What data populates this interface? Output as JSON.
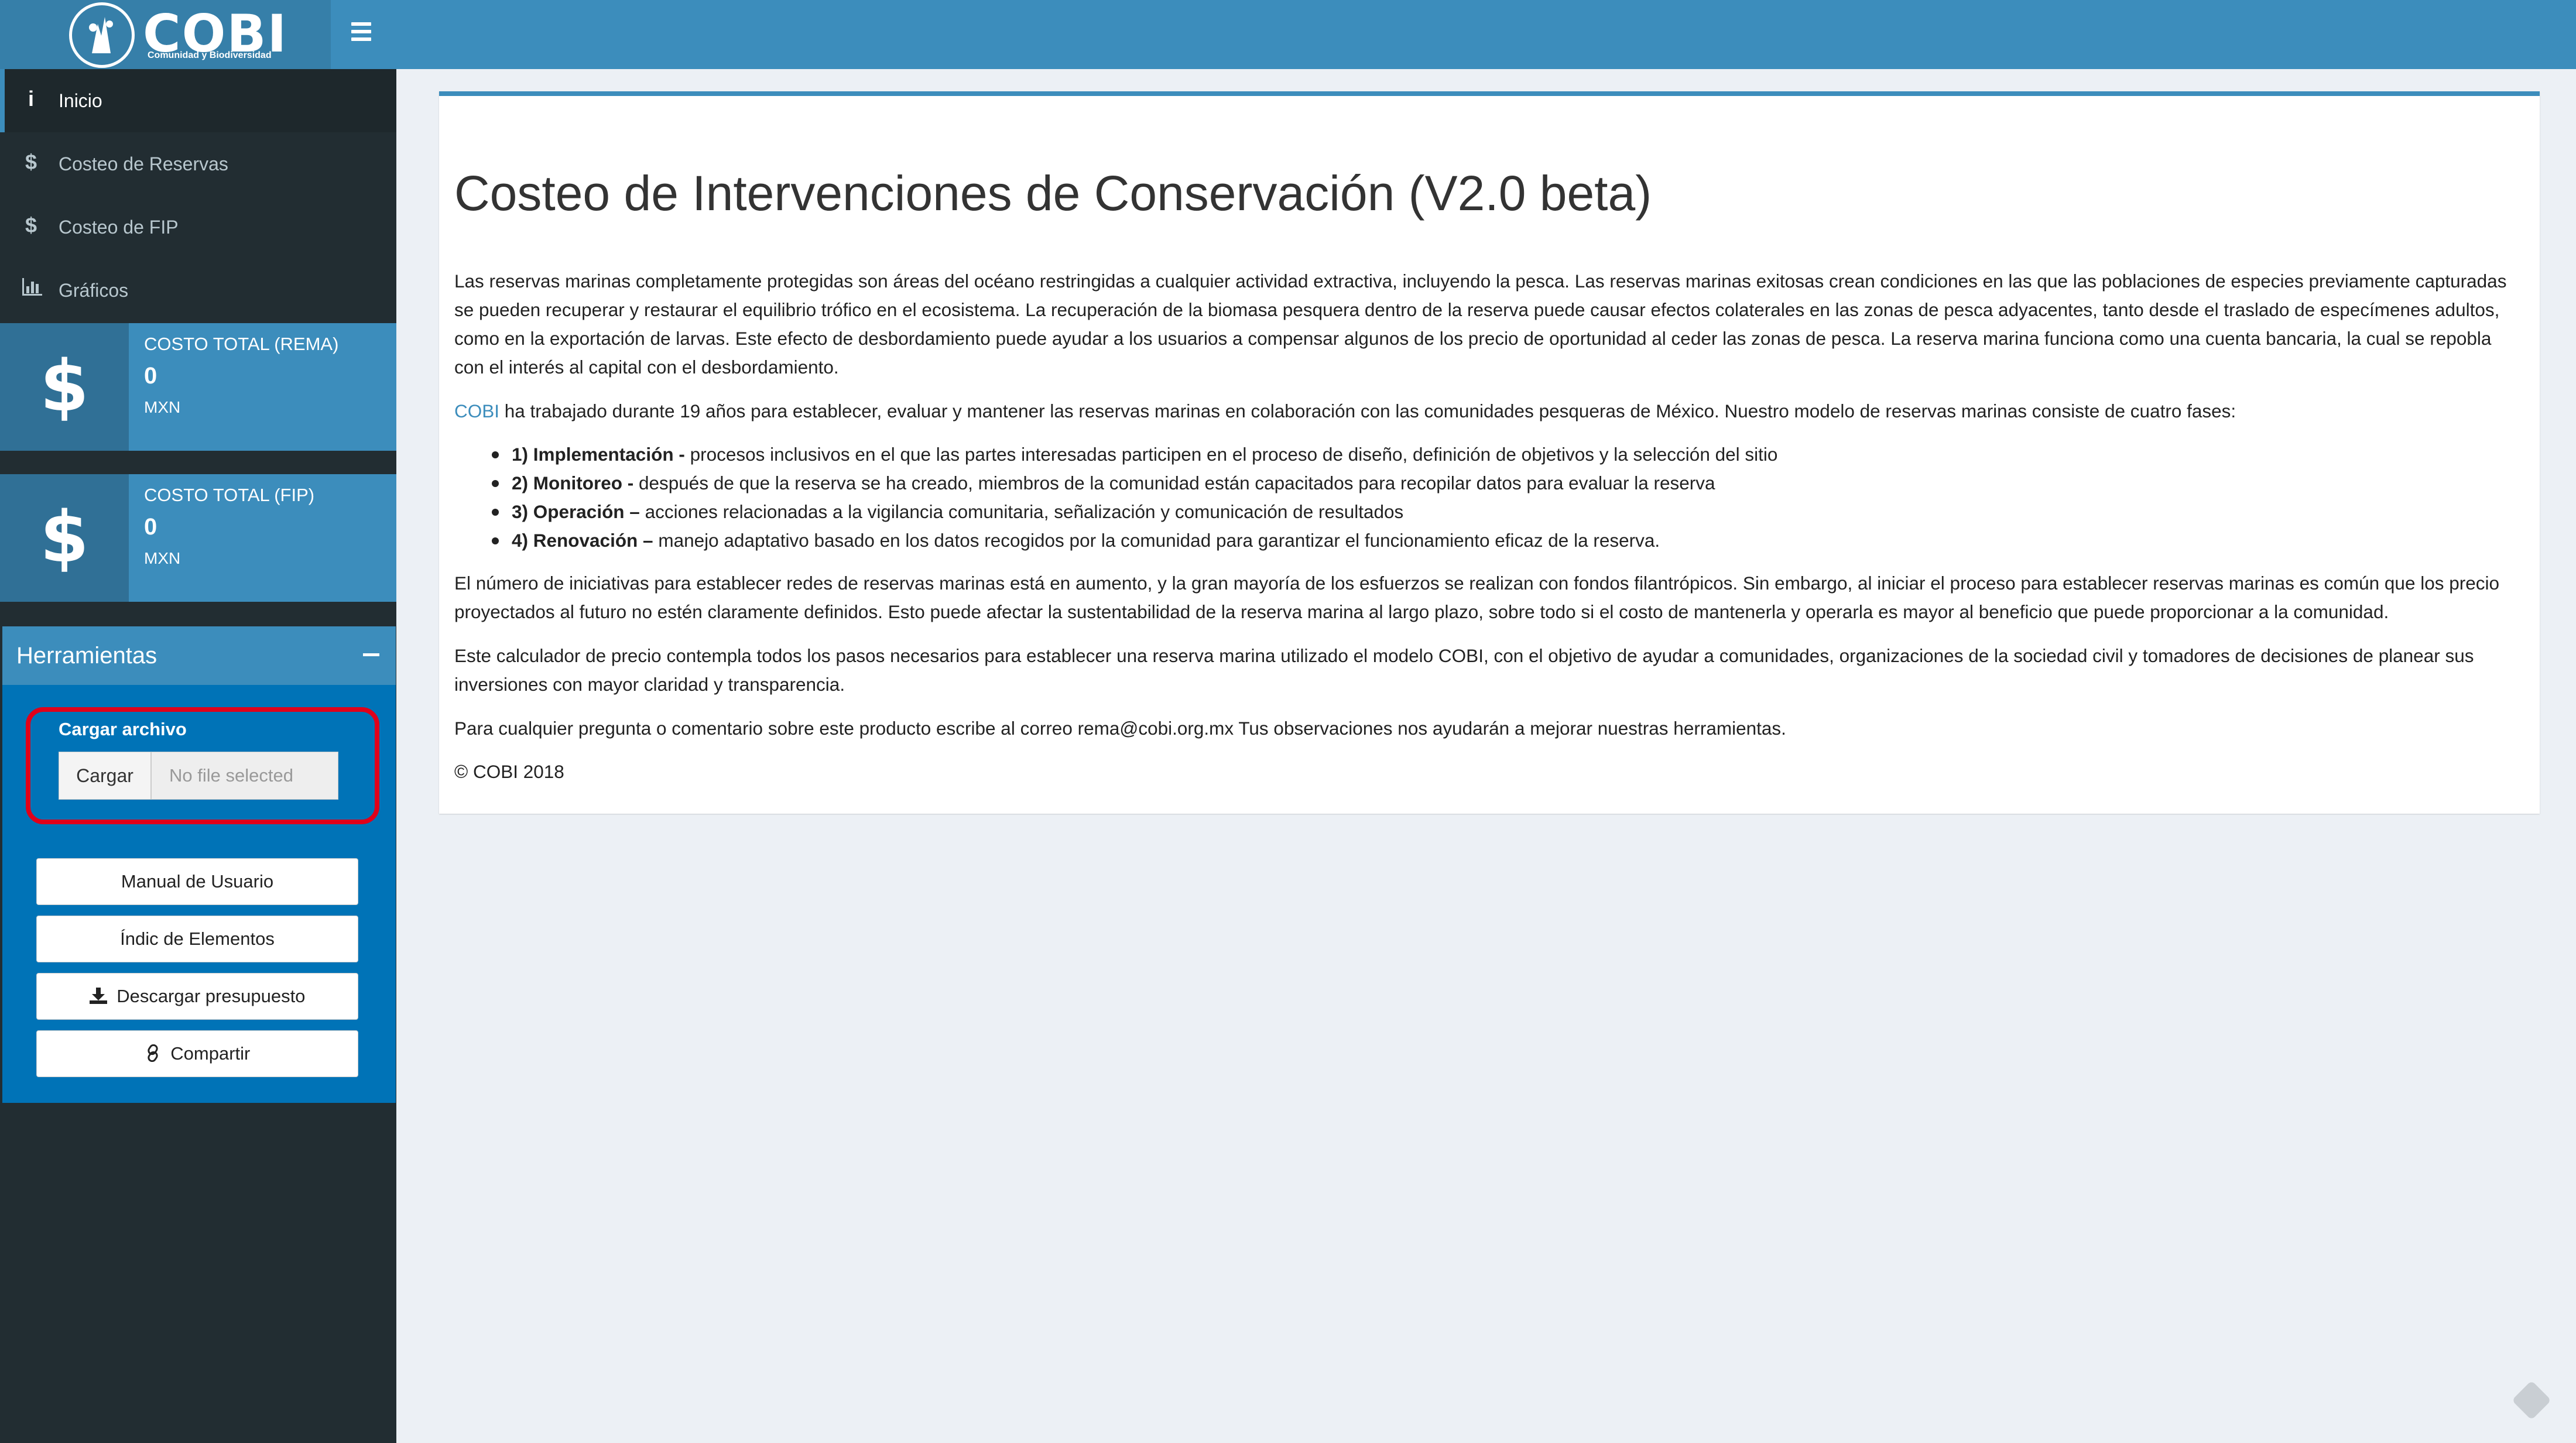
{
  "header": {
    "logo_text": "COBI",
    "logo_subtitle": "Comunidad y Biodiversidad",
    "menu_toggle_icon": "hamburger-icon"
  },
  "sidebar": {
    "items": [
      {
        "icon": "info-icon",
        "glyph": "i",
        "label": "Inicio",
        "active": true
      },
      {
        "icon": "dollar-icon",
        "glyph": "$",
        "label": "Costeo de Reservas",
        "active": false
      },
      {
        "icon": "dollar-icon",
        "glyph": "$",
        "label": "Costeo de FIP",
        "active": false
      },
      {
        "icon": "bar-chart-icon",
        "glyph": "📊",
        "label": "Gráficos",
        "active": false
      }
    ],
    "infoboxes": [
      {
        "icon": "dollar-icon",
        "glyph": "$",
        "title": "COSTO TOTAL (REMA)",
        "value": "0",
        "unit": "MXN"
      },
      {
        "icon": "dollar-icon",
        "glyph": "$",
        "title": "COSTO TOTAL (FIP)",
        "value": "0",
        "unit": "MXN"
      }
    ],
    "tools": {
      "title": "Herramientas",
      "upload_label": "Cargar archivo",
      "upload_button": "Cargar",
      "upload_placeholder": "No file selected",
      "buttons": {
        "manual": "Manual de Usuario",
        "index": "Índic de Elementos",
        "download": "Descargar presupuesto",
        "share": "Compartir"
      }
    }
  },
  "main": {
    "title": "Costeo de Intervenciones de Conservación (V2.0 beta)",
    "p1": "Las reservas marinas completamente protegidas son áreas del océano restringidas a cualquier actividad extractiva, incluyendo la pesca. Las reservas marinas exitosas crean condiciones en las que las poblaciones de especies previamente capturadas se pueden recuperar y restaurar el equilibrio trófico en el ecosistema. La recuperación de la biomasa pesquera dentro de la reserva puede causar efectos colaterales en las zonas de pesca adyacentes, tanto desde el traslado de especímenes adultos, como en la exportación de larvas. Este efecto de desbordamiento puede ayudar a los usuarios a compensar algunos de los precio de oportunidad al ceder las zonas de pesca. La reserva marina funciona como una cuenta bancaria, la cual se repobla con el interés al capital con el desbordamiento.",
    "p2_link": "COBI",
    "p2_text": " ha trabajado durante 19 años para establecer, evaluar y mantener las reservas marinas en colaboración con las comunidades pesqueras de México. Nuestro modelo de reservas marinas consiste de cuatro fases:",
    "phases": [
      {
        "name": "1) Implementación -",
        "desc": " procesos inclusivos en el que las partes interesadas participen en el proceso de diseño, definición de objetivos y la selección del sitio"
      },
      {
        "name": "2) Monitoreo -",
        "desc": " después de que la reserva se ha creado, miembros de la comunidad están capacitados para recopilar datos para evaluar la reserva"
      },
      {
        "name": "3) Operación –",
        "desc": " acciones relacionadas a la vigilancia comunitaria, señalización y comunicación de resultados"
      },
      {
        "name": "4) Renovación –",
        "desc": " manejo adaptativo basado en los datos recogidos por la comunidad para garantizar el funcionamiento eficaz de la reserva."
      }
    ],
    "p3": "El número de iniciativas para establecer redes de reservas marinas está en aumento, y la gran mayoría de los esfuerzos se realizan con fondos filantrópicos. Sin embargo, al iniciar el proceso para establecer reservas marinas es común que los precio proyectados al futuro no estén claramente definidos. Esto puede afectar la sustentabilidad de la reserva marina al largo plazo, sobre todo si el costo de mantenerla y operarla es mayor al beneficio que puede proporcionar a la comunidad.",
    "p4": "Este calculador de precio contempla todos los pasos necesarios para establecer una reserva marina utilizado el modelo COBI, con el objetivo de ayudar a comunidades, organizaciones de la sociedad civil y tomadores de decisiones de planear sus inversiones con mayor claridad y transparencia.",
    "p5": "Para cualquier pregunta o comentario sobre este producto escribe al correo rema@cobi.org.mx Tus observaciones nos ayudarán a mejorar nuestras herramientas.",
    "copyright": "© COBI 2018"
  },
  "colors": {
    "header": "#3c8dbc",
    "logo_bg": "#367fa9",
    "sidebar": "#222d32",
    "tools_bg": "#0073b7",
    "highlight": "#e0001a",
    "page_bg": "#ecf0f5"
  }
}
